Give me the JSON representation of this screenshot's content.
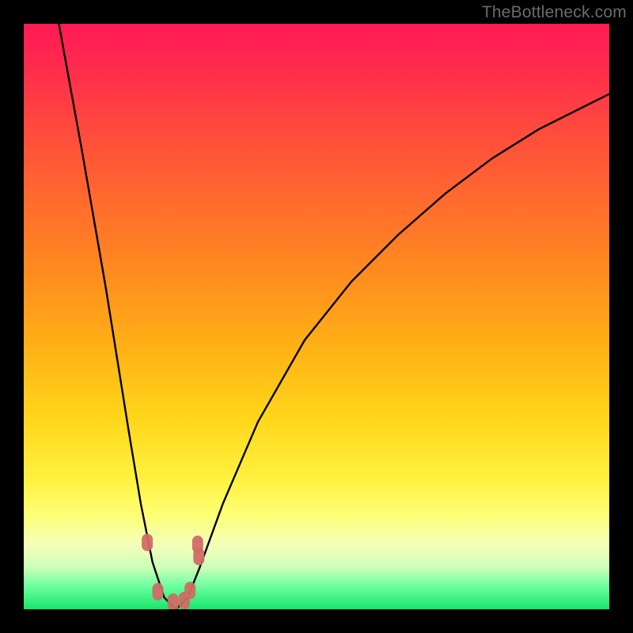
{
  "watermark": "TheBottleneck.com",
  "chart_data": {
    "type": "line",
    "title": "",
    "xlabel": "",
    "ylabel": "",
    "xlim": [
      0,
      100
    ],
    "ylim": [
      0,
      100
    ],
    "grid": false,
    "curve_note": "V-shaped curve: steep descent on the left, minimum near x≈25, slow asymptotic rise to the right. Values below are percentage heights read against the vertical gradient (0=bottom/green, 100=top/red).",
    "series": [
      {
        "name": "curve",
        "x": [
          6,
          10,
          14,
          18,
          20,
          22,
          24,
          26,
          28,
          30,
          34,
          40,
          48,
          56,
          64,
          72,
          80,
          88,
          96,
          100
        ],
        "values": [
          100,
          78,
          55,
          30,
          18,
          8,
          2,
          0,
          2,
          7,
          18,
          32,
          46,
          56,
          64,
          71,
          77,
          82,
          86,
          88
        ]
      }
    ],
    "valley_markers_note": "Small rounded markers clustered around the curve minimum.",
    "valley_markers": [
      {
        "x": 21.1,
        "y": 11.4
      },
      {
        "x": 22.9,
        "y": 3.0
      },
      {
        "x": 25.5,
        "y": 1.2
      },
      {
        "x": 27.4,
        "y": 1.5
      },
      {
        "x": 28.4,
        "y": 3.2
      },
      {
        "x": 29.7,
        "y": 11.1
      },
      {
        "x": 29.9,
        "y": 9.0
      }
    ],
    "gradient_colormap": [
      "#ff1a54",
      "#ffd51a",
      "#18e66b"
    ]
  }
}
